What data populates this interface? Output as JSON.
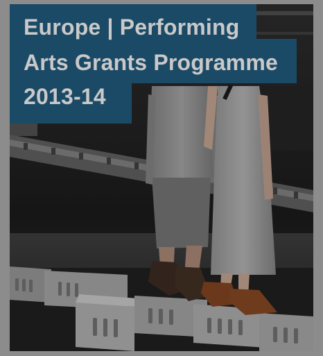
{
  "title": {
    "lines": [
      "Europe | Performing",
      "Arts Grants Programme",
      "2013-14"
    ]
  },
  "colors": {
    "background": "#8c8c8c",
    "title_band": "#1b4a66",
    "title_text": "#c9c9c9"
  }
}
